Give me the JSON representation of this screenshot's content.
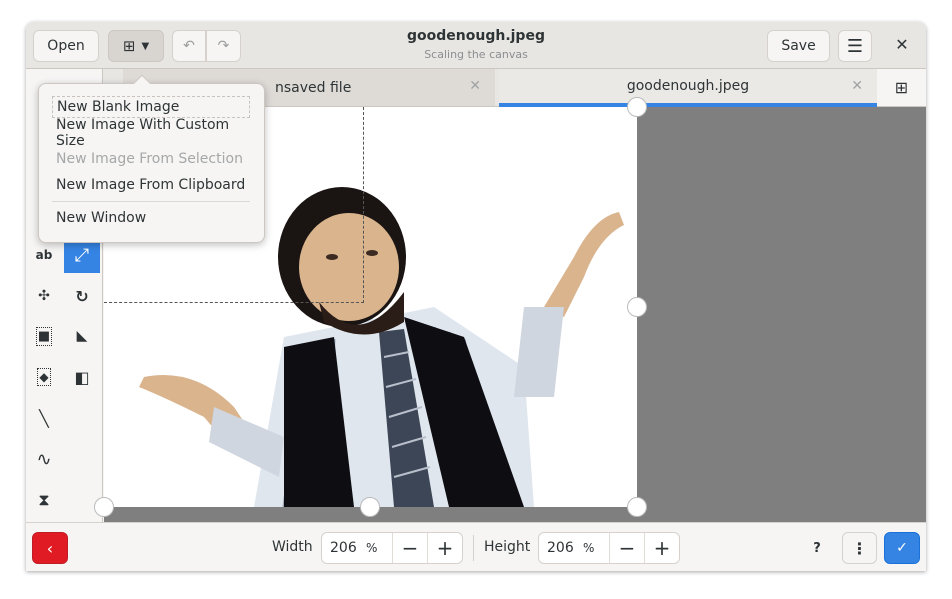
{
  "header": {
    "open_label": "Open",
    "title": "goodenough.jpeg",
    "subtitle": "Scaling the canvas",
    "save_label": "Save"
  },
  "tabs": [
    {
      "label": "Unsaved file",
      "visible_label": "nsaved file",
      "active": false
    },
    {
      "label": "goodenough.jpeg",
      "active": true
    }
  ],
  "new_menu": {
    "items": [
      {
        "label": "New Blank Image",
        "enabled": true,
        "focused": true
      },
      {
        "label": "New Image With Custom Size",
        "enabled": true
      },
      {
        "label": "New Image From Selection",
        "enabled": false
      },
      {
        "label": "New Image From Clipboard",
        "enabled": true
      },
      {
        "label": "New Window",
        "enabled": true
      }
    ]
  },
  "tools": [
    {
      "name": "text-tool",
      "glyph": "ab"
    },
    {
      "name": "scale-tool",
      "glyph": "⤢",
      "active": true
    },
    {
      "name": "filters-tool",
      "glyph": "✣"
    },
    {
      "name": "rotate-tool",
      "glyph": "↻"
    },
    {
      "name": "rect-select-tool",
      "glyph": "■"
    },
    {
      "name": "skew-tool",
      "glyph": "◣"
    },
    {
      "name": "free-select-tool",
      "glyph": "◆"
    },
    {
      "name": "color-tool",
      "glyph": "◧"
    },
    {
      "name": "line-tool",
      "glyph": "╲"
    },
    {
      "name": "curve-tool",
      "glyph": "∿"
    },
    {
      "name": "shape-tool",
      "glyph": "⧗"
    }
  ],
  "bottom": {
    "width_label": "Width",
    "width_value": "206",
    "width_unit": "%",
    "height_label": "Height",
    "height_value": "206",
    "height_unit": "%",
    "minus": "−",
    "plus": "+"
  },
  "colors": {
    "accent": "#3584e4",
    "destructive": "#e01b24"
  }
}
